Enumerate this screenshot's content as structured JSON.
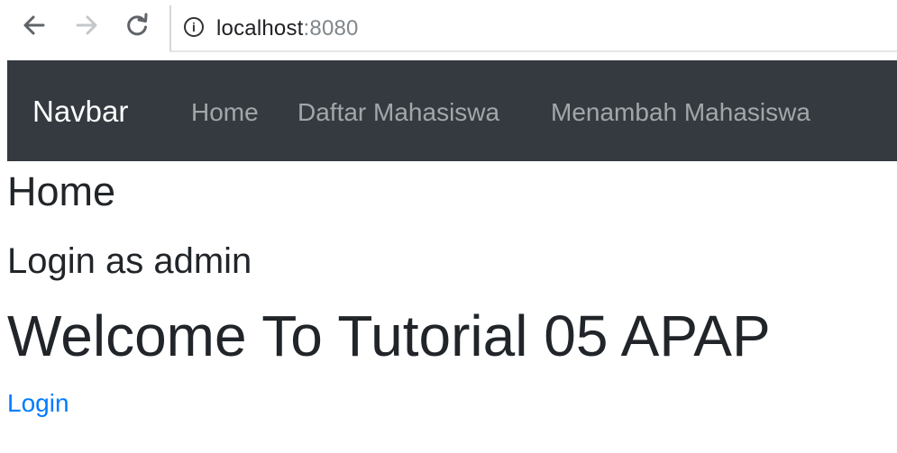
{
  "browser": {
    "back_icon": "arrow-left-icon",
    "forward_icon": "arrow-right-icon",
    "reload_icon": "reload-icon",
    "info_icon": "info-icon",
    "info_glyph": "i",
    "url_host": "localhost",
    "url_port": ":8080"
  },
  "navbar": {
    "brand": "Navbar",
    "links": [
      {
        "label": "Home"
      },
      {
        "label": "Daftar Mahasiswa"
      },
      {
        "label": "Menambah Mahasiswa"
      }
    ],
    "background_color": "#343a40"
  },
  "main": {
    "heading": "Home",
    "login_status": "Login as admin",
    "welcome": "Welcome To Tutorial 05 APAP",
    "login_link": "Login",
    "link_color": "#007bff"
  }
}
